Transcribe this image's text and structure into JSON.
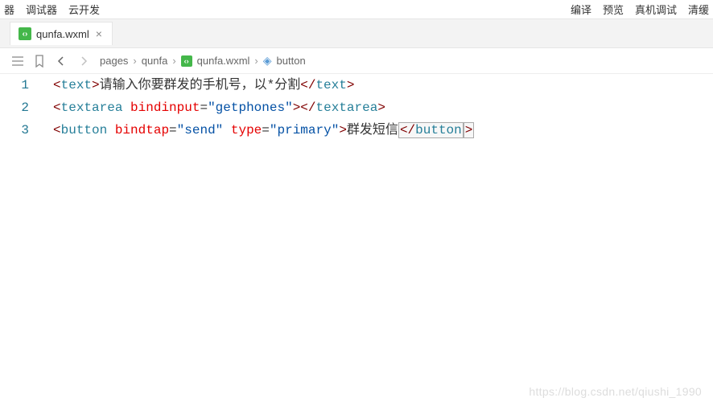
{
  "topMenu": {
    "left": [
      "器",
      "调试器",
      "云开发"
    ],
    "right": [
      "编译",
      "预览",
      "真机调试",
      "清缓"
    ]
  },
  "tab": {
    "filename": "qunfa.wxml",
    "iconGlyph": "‹›"
  },
  "breadcrumb": {
    "items": [
      "pages",
      "qunfa"
    ],
    "file": "qunfa.wxml",
    "symbol": "button"
  },
  "code": {
    "line1": {
      "tag": "text",
      "content": "请输入你要群发的手机号，以*分割"
    },
    "line2": {
      "tag": "textarea",
      "attr1Name": "bindinput",
      "attr1Val": "\"getphones\""
    },
    "line3": {
      "tag": "button",
      "attr1Name": "bindtap",
      "attr1Val": "\"send\"",
      "attr2Name": "type",
      "attr2Val": "\"primary\"",
      "content": "群发短信"
    },
    "lineNumbers": [
      "1",
      "2",
      "3"
    ]
  },
  "watermark": "https://blog.csdn.net/qiushi_1990"
}
